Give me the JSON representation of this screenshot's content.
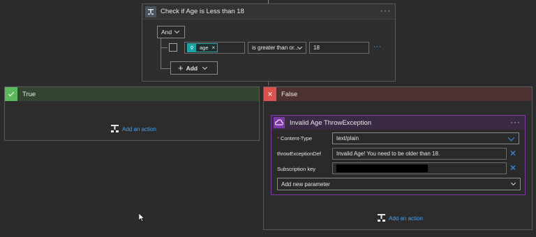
{
  "condition": {
    "title": "Check if Age is Less than 18",
    "and_label": "And",
    "token_label": "age",
    "operator": "is greater than or...",
    "value": "18",
    "add_label": "Add",
    "more": "···"
  },
  "true_branch": {
    "title": "True",
    "add_action": "Add an action"
  },
  "false_branch": {
    "title": "False",
    "add_action": "Add an action",
    "action": {
      "title": "Invalid Age ThrowException",
      "more": "···",
      "fields": [
        {
          "label": "Content-Type",
          "required": "*",
          "value": "text/plain"
        },
        {
          "label": "throwExceptionDef",
          "value": "Invalid Age! You need to be older than 18."
        },
        {
          "label": "Subscription key",
          "value": ""
        }
      ],
      "add_parameter": "Add new parameter"
    }
  },
  "colors": {
    "true_header": "#314531",
    "false_header": "#4d3231",
    "true_icon": "#5cb85c",
    "false_icon": "#d9534f",
    "accent": "#4aa0f0",
    "action_icon": "#7c3aa8"
  }
}
